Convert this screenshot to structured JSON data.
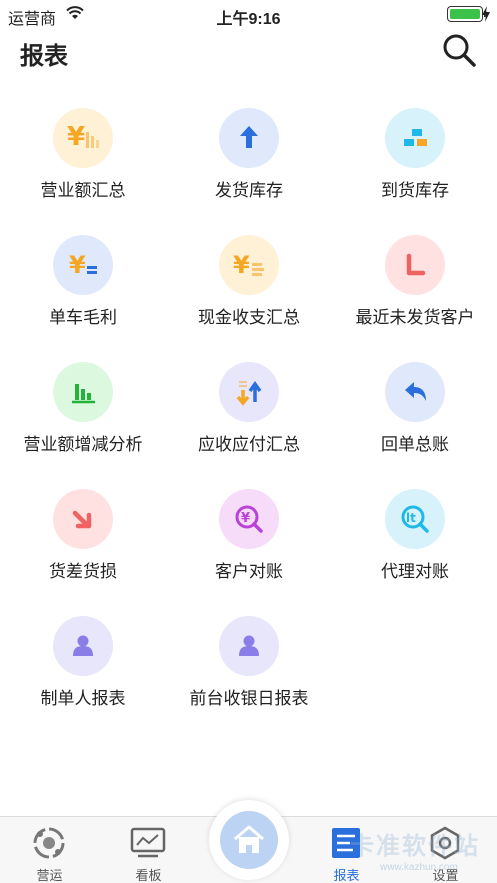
{
  "status": {
    "carrier": "运营商",
    "time": "上午9:16"
  },
  "header": {
    "title": "报表"
  },
  "reports": [
    {
      "label": "营业额汇总",
      "icon": "revenue-summary-icon",
      "bg": "#fff1d6",
      "color": "#f5a623"
    },
    {
      "label": "发货库存",
      "icon": "upload-arrow-icon",
      "bg": "#dfe9fb",
      "color": "#2a6fdb"
    },
    {
      "label": "到货库存",
      "icon": "stacked-boxes-icon",
      "bg": "#d8f2fb",
      "color": "#1fb8e8"
    },
    {
      "label": "单车毛利",
      "icon": "yuan-equals-icon",
      "bg": "#dfe9fb",
      "color": "#f5a623"
    },
    {
      "label": "现金收支汇总",
      "icon": "yuan-coins-icon",
      "bg": "#fff1d6",
      "color": "#f5a623"
    },
    {
      "label": "最近未发货客户",
      "icon": "l-corner-icon",
      "bg": "#ffe1e1",
      "color": "#f06262"
    },
    {
      "label": "营业额增减分析",
      "icon": "bar-chart-icon",
      "bg": "#dcf8df",
      "color": "#22b33a"
    },
    {
      "label": "应收应付汇总",
      "icon": "up-down-arrows-icon",
      "bg": "#e7e6fb",
      "color": "#f5a623"
    },
    {
      "label": "回单总账",
      "icon": "reply-arrow-icon",
      "bg": "#dfe9fb",
      "color": "#2a6fdb"
    },
    {
      "label": "货差货损",
      "icon": "down-right-arrow-icon",
      "bg": "#ffe1e1",
      "color": "#f06262"
    },
    {
      "label": "客户对账",
      "icon": "yuan-magnifier-icon",
      "bg": "#f6dcf8",
      "color": "#b843d6"
    },
    {
      "label": "代理对账",
      "icon": "lt-magnifier-icon",
      "bg": "#d8f2fb",
      "color": "#1fb8e8"
    },
    {
      "label": "制单人报表",
      "icon": "person-icon",
      "bg": "#e7e6fb",
      "color": "#8a7de8"
    },
    {
      "label": "前台收银日报表",
      "icon": "person-icon",
      "bg": "#e7e6fb",
      "color": "#8a7de8"
    }
  ],
  "tabs": [
    {
      "label": "营运",
      "icon": "operations-icon"
    },
    {
      "label": "看板",
      "icon": "dashboard-monitor-icon"
    },
    {
      "label": "报表",
      "icon": "report-doc-icon",
      "active": true
    },
    {
      "label": "设置",
      "icon": "settings-gear-icon"
    }
  ],
  "home_icon": "home-icon",
  "watermark": "卡准软件站",
  "watermark_url": "www.kazhun.com"
}
